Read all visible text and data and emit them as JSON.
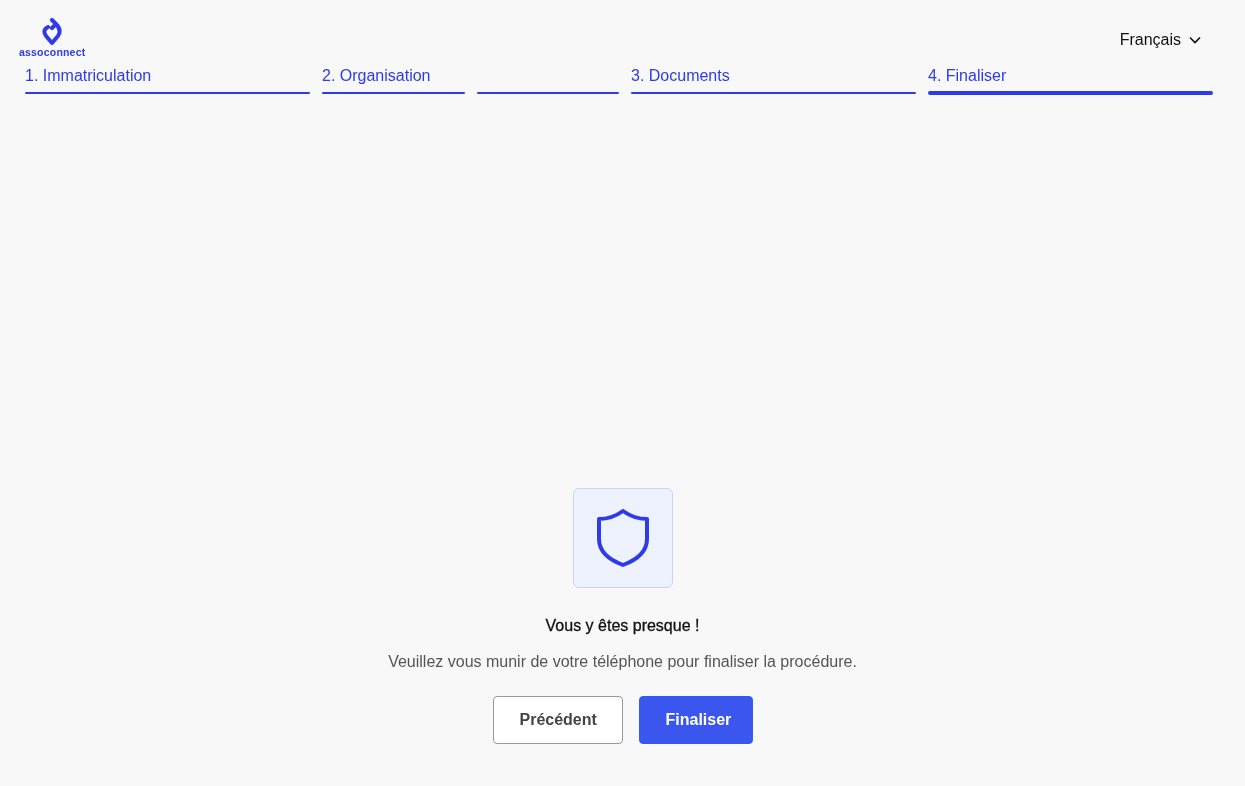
{
  "header": {
    "logo_text": "assoconnect",
    "language": "Français"
  },
  "steps": [
    {
      "label": "1. Immatriculation",
      "kind": "main",
      "selected": false
    },
    {
      "label": "2. Organisation",
      "kind": "sub",
      "selected": false
    },
    {
      "kind": "sub",
      "selected": false
    },
    {
      "label": "3. Documents",
      "kind": "main",
      "selected": false
    },
    {
      "label": "4. Finaliser",
      "kind": "main",
      "selected": true
    }
  ],
  "content": {
    "title": "Vous y êtes presque !",
    "message": "Veuillez vous munir de votre téléphone pour finaliser la procédure."
  },
  "buttons": [
    {
      "label": "Précédent",
      "kind": "secondary"
    },
    {
      "label": "Finaliser",
      "kind": "primary"
    }
  ]
}
